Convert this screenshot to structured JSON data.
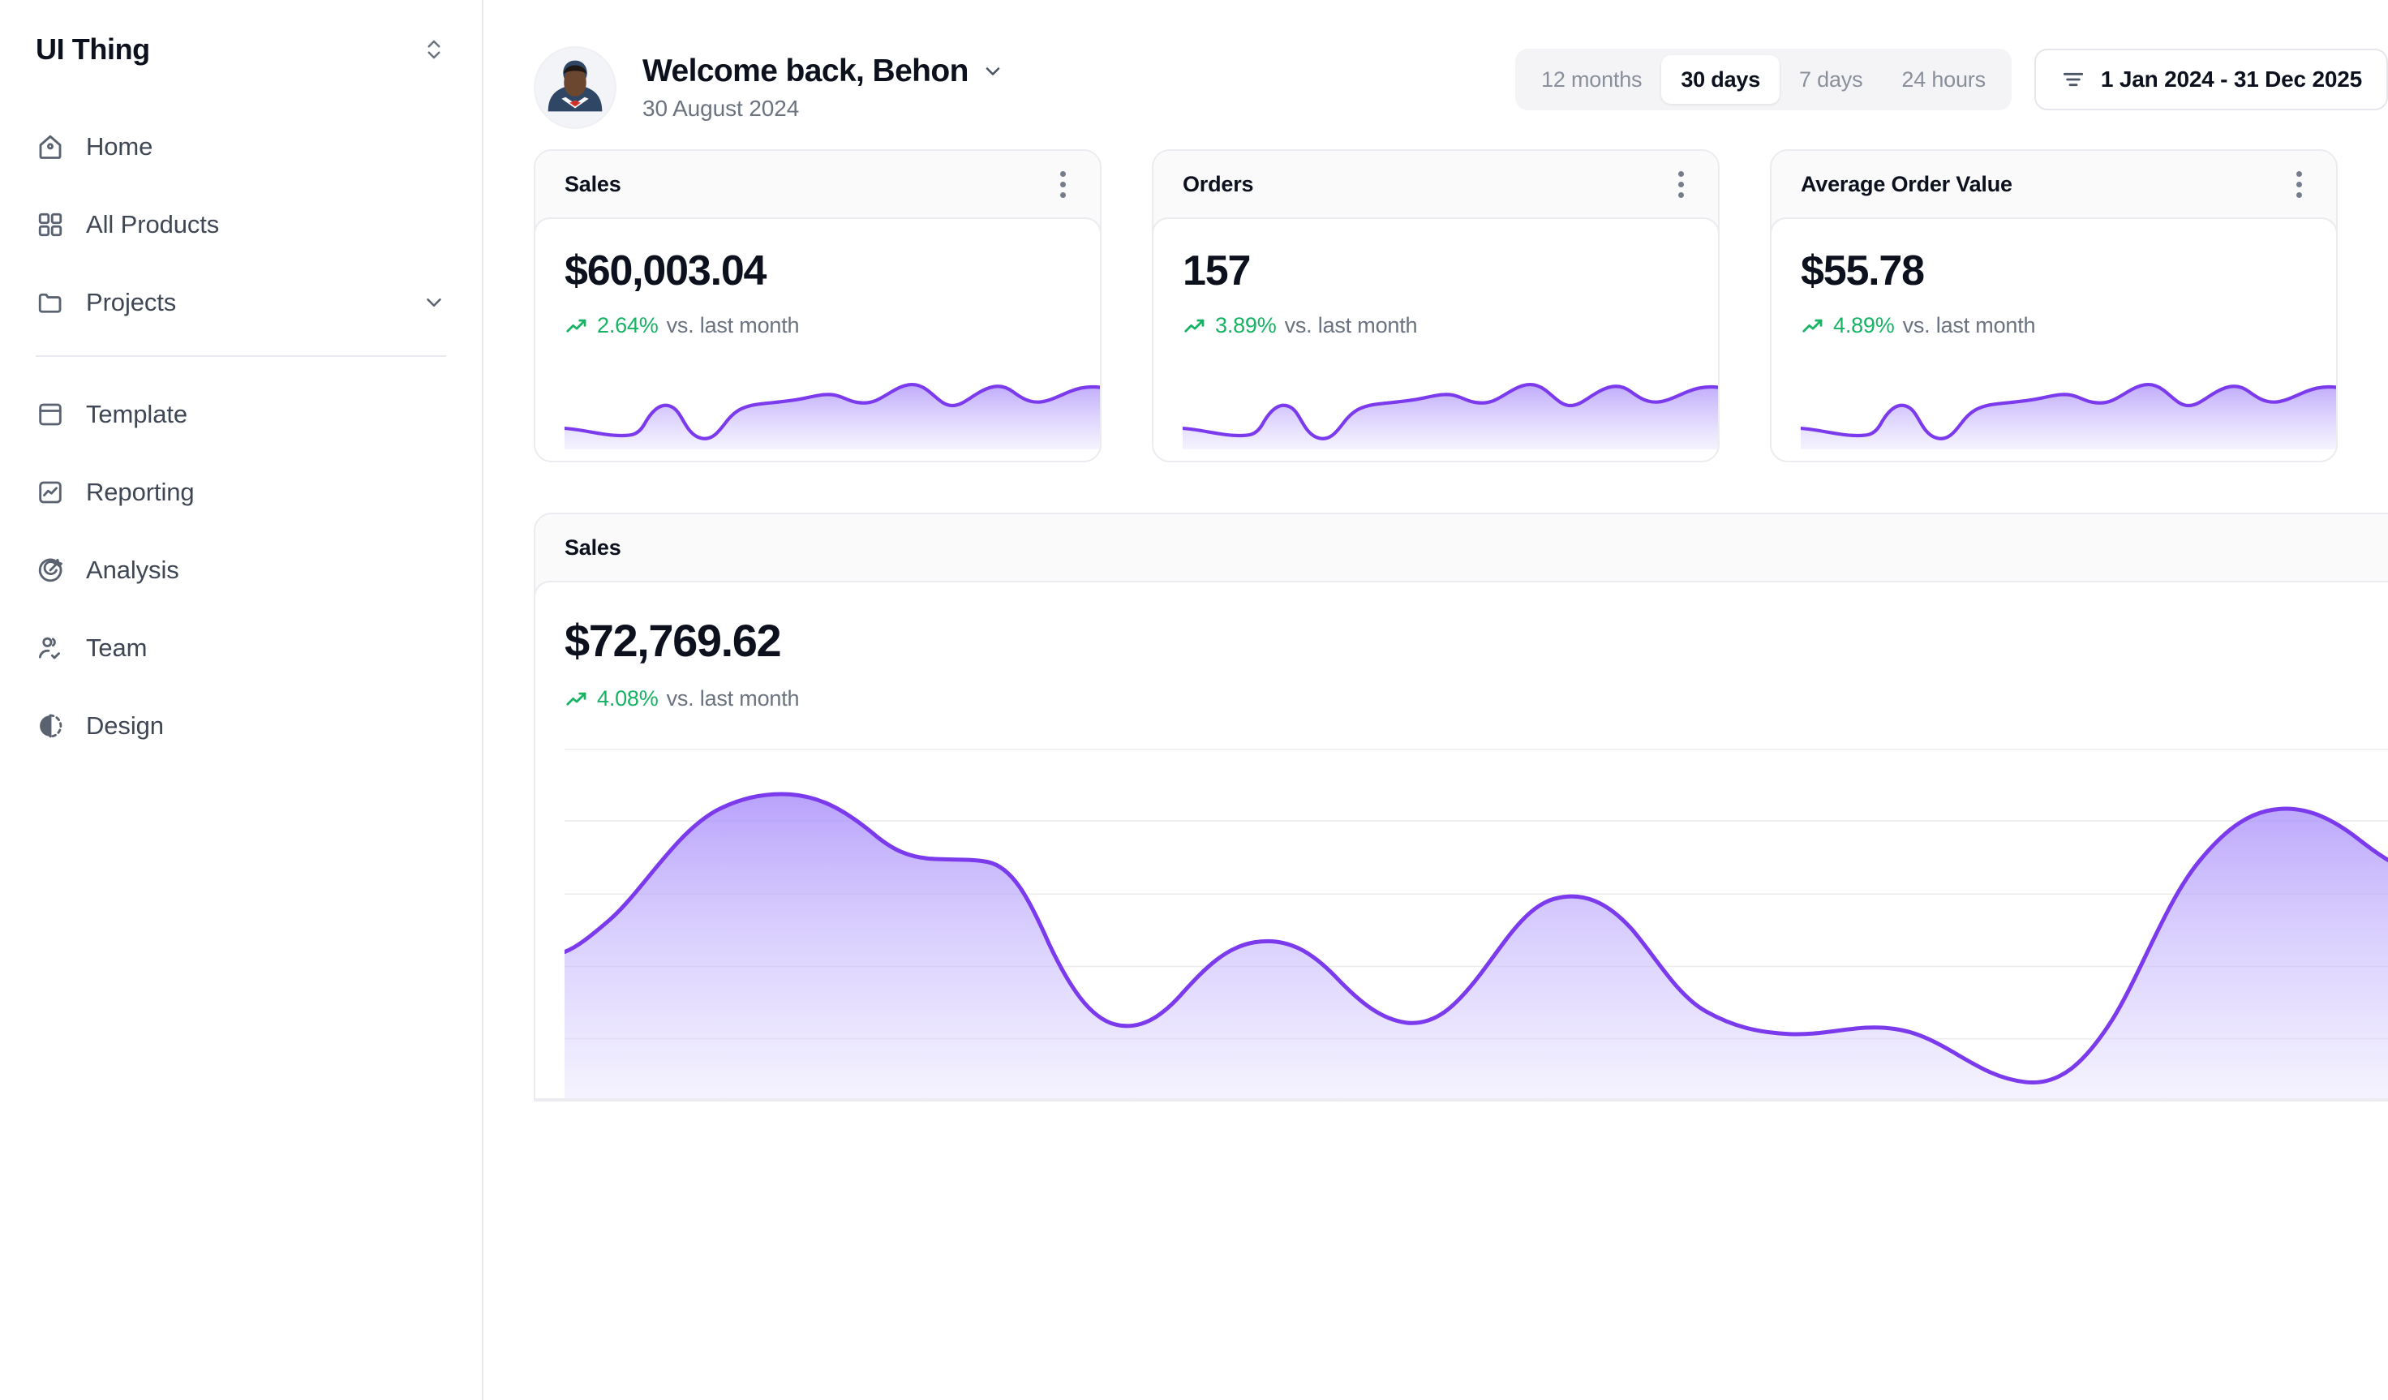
{
  "sidebar": {
    "brand": "UI Thing",
    "collapse_icon": "chevron-up-down-icon",
    "items": [
      {
        "label": "Home",
        "icon": "home-icon"
      },
      {
        "label": "All Products",
        "icon": "grid-icon"
      },
      {
        "label": "Projects",
        "icon": "folder-icon",
        "trailing_icon": "chevron-down-icon"
      },
      {
        "label": "Template",
        "icon": "layout-panel-icon"
      },
      {
        "label": "Reporting",
        "icon": "chart-line-icon"
      },
      {
        "label": "Analysis",
        "icon": "target-pen-icon"
      },
      {
        "label": "Team",
        "icon": "users-check-icon"
      },
      {
        "label": "Design",
        "icon": "contrast-circle-icon"
      }
    ]
  },
  "header": {
    "avatar_alt": "user-avatar",
    "title": "Welcome back, Behon",
    "title_chevron": "chevron-down-icon",
    "date": "30 August 2024",
    "range_tabs": [
      {
        "label": "12 months",
        "active": false
      },
      {
        "label": "30 days",
        "active": true
      },
      {
        "label": "7 days",
        "active": false
      },
      {
        "label": "24 hours",
        "active": false
      }
    ],
    "date_range": "1 Jan 2024 - 31 Dec 2025",
    "date_range_icon": "filter-lines-icon"
  },
  "stat_cards": [
    {
      "title": "Sales",
      "value": "$60,003.04",
      "delta": "2.64%",
      "delta_suffix": "vs. last month",
      "trend_icon": "trend-up-icon",
      "menu_icon": "more-vertical-icon"
    },
    {
      "title": "Orders",
      "value": "157",
      "delta": "3.89%",
      "delta_suffix": "vs. last month",
      "trend_icon": "trend-up-icon",
      "menu_icon": "more-vertical-icon"
    },
    {
      "title": "Average Order Value",
      "value": "$55.78",
      "delta": "4.89%",
      "delta_suffix": "vs. last month",
      "trend_icon": "trend-up-icon",
      "menu_icon": "more-vertical-icon"
    }
  ],
  "main_chart_card": {
    "title": "Sales",
    "value": "$72,769.62",
    "delta": "4.08%",
    "delta_suffix": "vs. last month",
    "trend_icon": "trend-up-icon",
    "menu_icon": "more-vertical-icon"
  },
  "colors": {
    "accent_purple": "#7c3aed",
    "positive_green": "#16b364",
    "text_primary": "#0c111d",
    "text_muted": "#6b7280",
    "card_header_bg": "#fafafb",
    "border": "#ebebf0"
  },
  "chart_data": [
    {
      "type": "area",
      "title": "Sales",
      "id": "main-sales-chart",
      "xlabel": "",
      "ylabel": "",
      "grid": true,
      "gridlines_y": 5,
      "legend": "none",
      "ylim": [
        0,
        100
      ],
      "x": [
        0,
        1,
        2,
        3,
        4,
        5,
        6,
        7,
        8,
        9,
        10,
        11,
        12,
        13,
        14,
        15,
        16,
        17,
        18,
        19,
        20
      ],
      "values": [
        34,
        36,
        52,
        78,
        86,
        84,
        80,
        78,
        30,
        18,
        22,
        40,
        48,
        38,
        20,
        16,
        52,
        60,
        26,
        10,
        14,
        72,
        92,
        88,
        80,
        78,
        76,
        74
      ]
    },
    {
      "type": "area",
      "id": "sales-sparkline",
      "title": "Sales",
      "grid": false,
      "ylim": [
        0,
        100
      ],
      "values": [
        22,
        18,
        14,
        12,
        52,
        20,
        10,
        16,
        44,
        58,
        56,
        60,
        70,
        56,
        54,
        62,
        82,
        72,
        58,
        66,
        84,
        74,
        62,
        60,
        72,
        80
      ]
    },
    {
      "type": "area",
      "id": "orders-sparkline",
      "title": "Orders",
      "grid": false,
      "ylim": [
        0,
        100
      ],
      "values": [
        22,
        18,
        14,
        12,
        52,
        20,
        10,
        16,
        44,
        58,
        56,
        60,
        70,
        56,
        54,
        62,
        82,
        72,
        58,
        66,
        84,
        74,
        62,
        60,
        72,
        80
      ]
    },
    {
      "type": "area",
      "id": "aov-sparkline",
      "title": "Average Order Value",
      "grid": false,
      "ylim": [
        0,
        100
      ],
      "values": [
        22,
        18,
        14,
        12,
        52,
        20,
        10,
        16,
        44,
        58,
        56,
        60,
        70,
        56,
        54,
        62,
        82,
        72,
        58,
        66,
        84,
        74,
        62,
        60,
        72,
        80
      ]
    }
  ]
}
